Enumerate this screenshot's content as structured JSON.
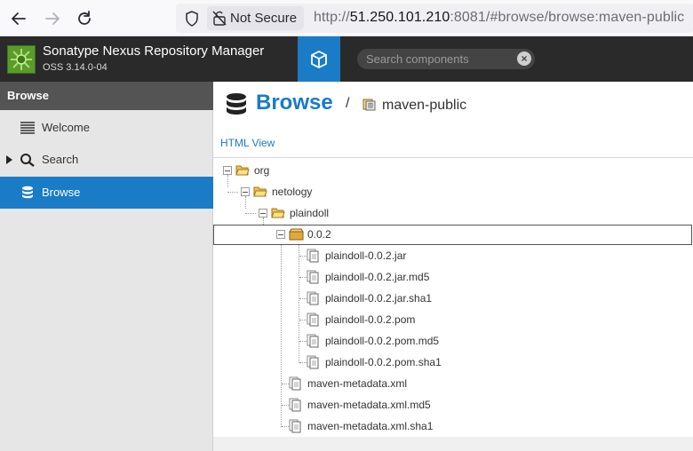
{
  "browser": {
    "security_label": "Not Secure",
    "url_scheme": "http://",
    "url_host": "51.250.101.210",
    "url_rest": ":8081/#browse/browse:maven-public"
  },
  "header": {
    "title": "Sonatype Nexus Repository Manager",
    "version": "OSS 3.14.0-04",
    "search_placeholder": "Search components"
  },
  "sidebar": {
    "heading": "Browse",
    "items": [
      {
        "label": "Welcome",
        "icon": "list-icon",
        "active": false
      },
      {
        "label": "Search",
        "icon": "search-icon",
        "active": false
      },
      {
        "label": "Browse",
        "icon": "database-icon",
        "active": true
      }
    ]
  },
  "main": {
    "title": "Browse",
    "separator": "/",
    "repository": "maven-public",
    "html_view_link": "HTML View"
  },
  "tree": {
    "org": "org",
    "netology": "netology",
    "plaindoll": "plaindoll",
    "version": "0.0.2",
    "version_files": [
      "plaindoll-0.0.2.jar",
      "plaindoll-0.0.2.jar.md5",
      "plaindoll-0.0.2.jar.sha1",
      "plaindoll-0.0.2.pom",
      "plaindoll-0.0.2.pom.md5",
      "plaindoll-0.0.2.pom.sha1"
    ],
    "metadata_files": [
      "maven-metadata.xml",
      "maven-metadata.xml.md5",
      "maven-metadata.xml.sha1"
    ]
  },
  "colors": {
    "accent": "#1a7bc7",
    "header_bg": "#2a2a2a",
    "sidebar_bg": "#e6e6e6"
  }
}
